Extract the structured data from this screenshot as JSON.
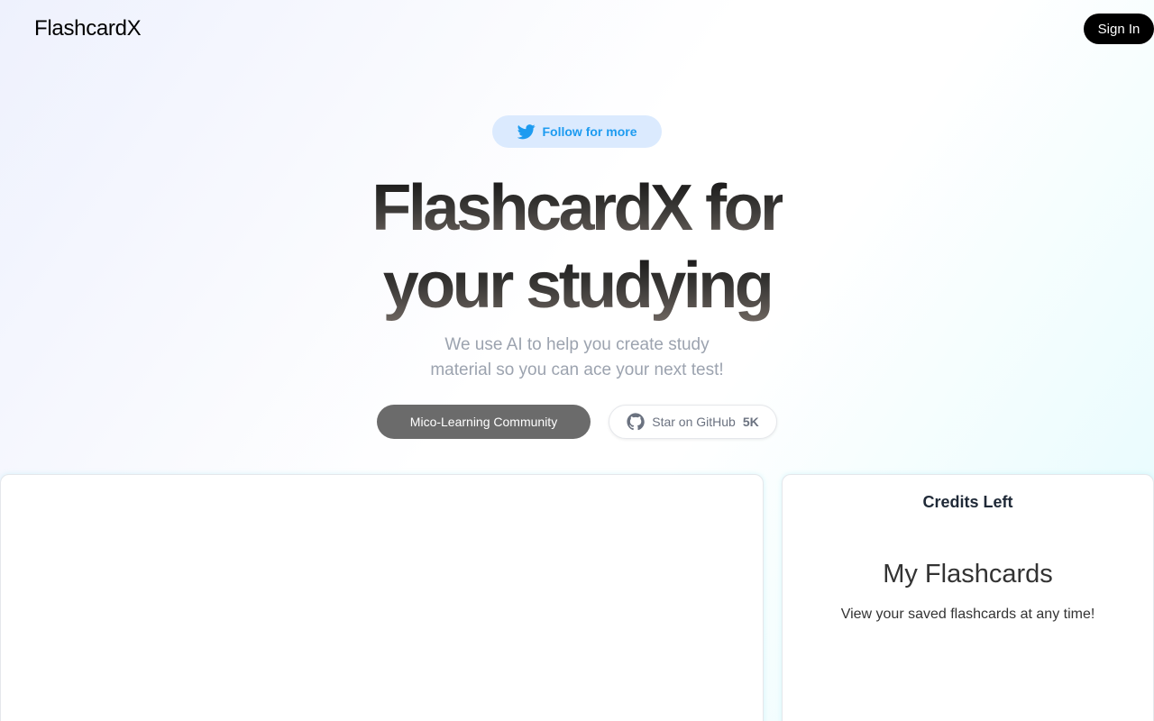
{
  "header": {
    "logo": "FlashcardX",
    "signin_label": "Sign In"
  },
  "hero": {
    "follow_label": "Follow for more",
    "title_line1": "FlashcardX for",
    "title_line2": "your studying",
    "subtitle_line1": "We use AI to help you create study",
    "subtitle_line2": "material so you can ace your next test!",
    "community_label": "Mico-Learning Community",
    "github_label": "Star on GitHub",
    "github_count": "5K"
  },
  "sidebar": {
    "credits_title": "Credits Left",
    "flashcards_title": "My Flashcards",
    "flashcards_subtitle": "View your saved flashcards at any time!"
  },
  "colors": {
    "twitter_blue": "#1d9bf0",
    "follow_bg": "#dbeafe",
    "signin_bg": "#000000",
    "community_bg": "#6b6b6b"
  },
  "icons": {
    "follow": "twitter-icon",
    "github": "github-icon"
  }
}
